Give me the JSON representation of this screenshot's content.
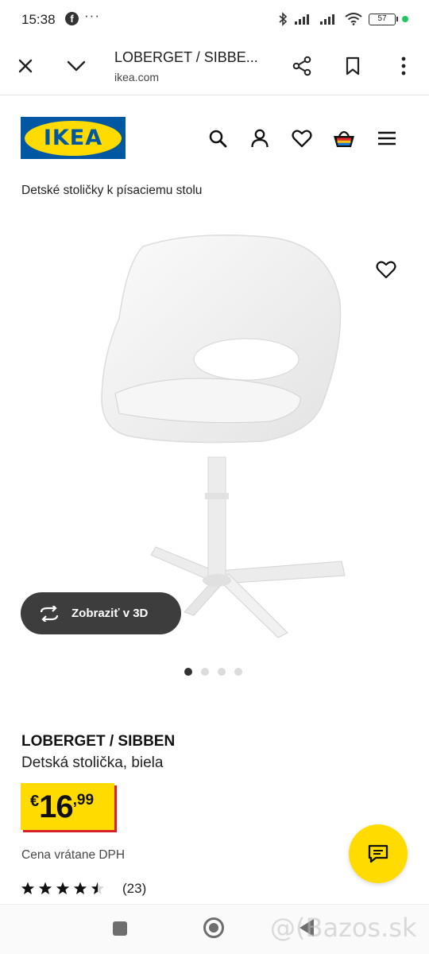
{
  "status_bar": {
    "time": "15:38",
    "notification_glyph": "f",
    "more": "···",
    "battery": "57"
  },
  "browser": {
    "title": "LOBERGET / SIBBE...",
    "domain": "ikea.com",
    "icons": [
      "close-icon",
      "chevron-down-icon",
      "share-icon",
      "bookmark-icon",
      "more-vert-icon"
    ]
  },
  "site": {
    "logo_text": "IKEA",
    "nav_icons": [
      "search-icon",
      "user-icon",
      "heart-icon",
      "basket-icon",
      "menu-icon"
    ],
    "brand_blue": "#0058a3",
    "brand_yellow": "#ffdb00"
  },
  "breadcrumb": "Detské stoličky k písaciemu stolu",
  "gallery": {
    "view3d_label": "Zobraziť v 3D",
    "slide_count": 4,
    "active_slide": 1
  },
  "product": {
    "name": "LOBERGET / SIBBEN",
    "description": "Detská stolička, biela",
    "price_currency": "€",
    "price_int": "16",
    "price_dec": ",99",
    "price_note": "Cena vrátane DPH",
    "rating": 4.5,
    "rating_max": 5,
    "rating_count": "(23)"
  },
  "watermark": "@(Bazos.sk"
}
